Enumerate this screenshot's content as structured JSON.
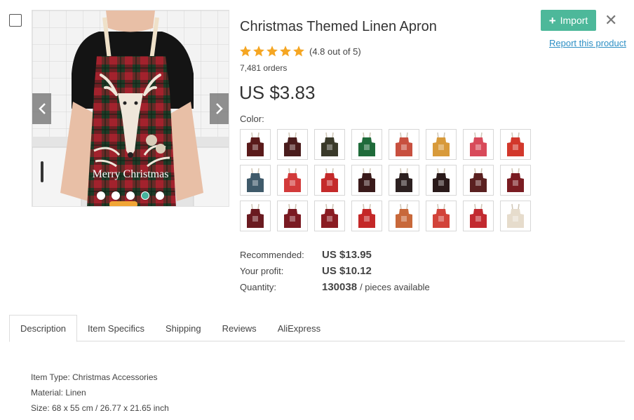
{
  "product": {
    "title": "Christmas Themed Linen Apron",
    "rating_text": "(4.8 out of 5)",
    "rating_value": 4.8,
    "orders": "7,481 orders",
    "price": "US $3.83",
    "color_label": "Color:",
    "image_text": "Merry Christmas"
  },
  "gallery": {
    "dot_count": 5,
    "active_dot": 3
  },
  "swatches": [
    {
      "name": "deer-black",
      "fill": "#5a1a1a"
    },
    {
      "name": "tree-dark",
      "fill": "#4a1c1c"
    },
    {
      "name": "merry-green",
      "fill": "#3a3a2a"
    },
    {
      "name": "green-plaid",
      "fill": "#1f6b3a"
    },
    {
      "name": "fair-isle-red",
      "fill": "#c8503f"
    },
    {
      "name": "fair-isle-yellow",
      "fill": "#d89a3a"
    },
    {
      "name": "fair-isle-pink",
      "fill": "#d84a5a"
    },
    {
      "name": "santa-red",
      "fill": "#d2382c"
    },
    {
      "name": "snowman-blue",
      "fill": "#3f5a6a"
    },
    {
      "name": "red-dots",
      "fill": "#d23a3a"
    },
    {
      "name": "wreath-red",
      "fill": "#c42a2a"
    },
    {
      "name": "black-wreath",
      "fill": "#3a1a1a"
    },
    {
      "name": "black-deer",
      "fill": "#2c2020"
    },
    {
      "name": "black-merry",
      "fill": "#2a1a1a"
    },
    {
      "name": "deer-plaid",
      "fill": "#5a2020"
    },
    {
      "name": "red-plaid",
      "fill": "#7a1c22"
    },
    {
      "name": "tartan-1",
      "fill": "#6a1a20"
    },
    {
      "name": "tartan-2",
      "fill": "#7a1a22"
    },
    {
      "name": "tartan-3",
      "fill": "#8a1c22"
    },
    {
      "name": "santa-wreath",
      "fill": "#c42828"
    },
    {
      "name": "gingerbread",
      "fill": "#c8683a"
    },
    {
      "name": "ornaments",
      "fill": "#d2433a"
    },
    {
      "name": "red-script",
      "fill": "#c22a30"
    },
    {
      "name": "merry-linen",
      "fill": "#e6dccc"
    }
  ],
  "pricing": {
    "recommended_label": "Recommended:",
    "recommended_value": "US $13.95",
    "profit_label": "Your profit:",
    "profit_value": "US $10.12",
    "quantity_label": "Quantity:",
    "quantity_value": "130038",
    "quantity_suffix": "/ pieces available"
  },
  "actions": {
    "import_label": "Import",
    "report_label": "Report this product"
  },
  "colors": {
    "accent": "#4db89a",
    "link": "#2d8fc4",
    "star": "#f5a623"
  },
  "tabs": [
    "Description",
    "Item Specifics",
    "Shipping",
    "Reviews",
    "AliExpress"
  ],
  "description": [
    "Item Type: Christmas Accessories",
    "Material: Linen",
    "Size: 68 x 55 cm / 26.77 x 21.65 inch"
  ]
}
